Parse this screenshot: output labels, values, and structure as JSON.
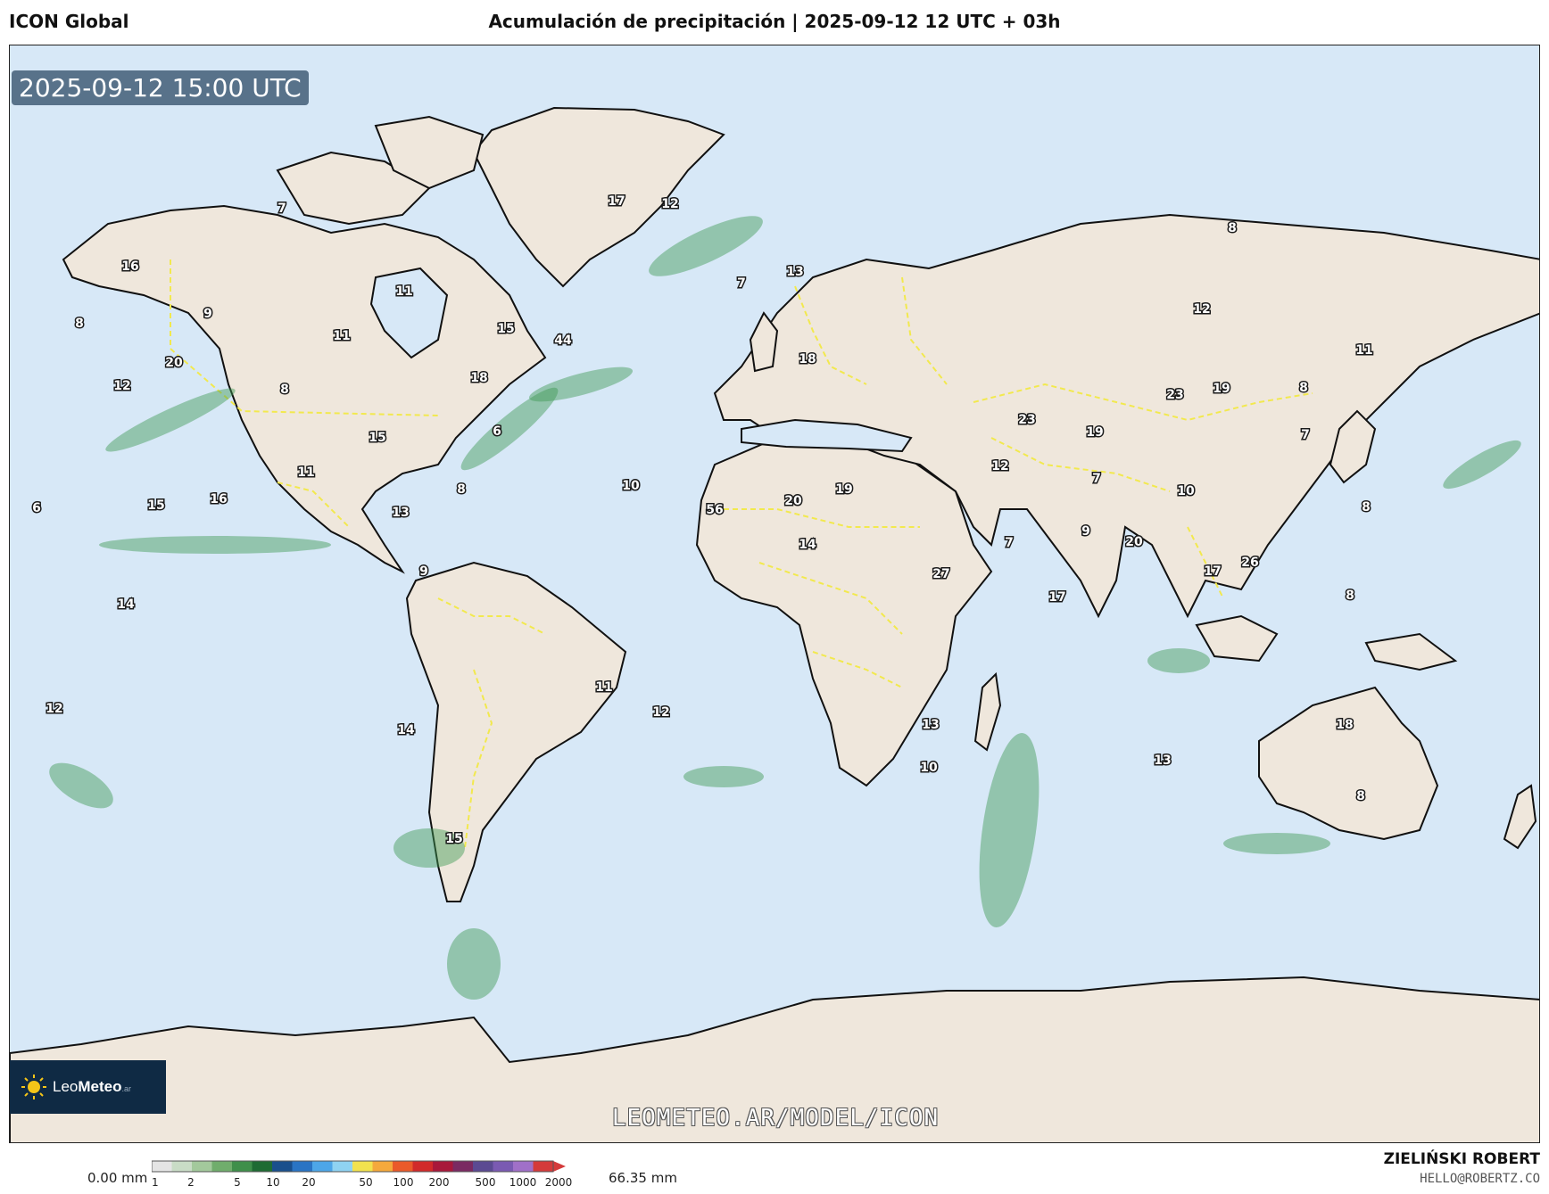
{
  "header": {
    "model": "ICON Global",
    "title": "Acumulación de precipitación | 2025-09-12 12 UTC + 03h"
  },
  "map": {
    "valid_time": "2025-09-12 15:00 UTC",
    "watermark": "LEOMETEO.AR/MODEL/ICON",
    "ocean_color": "#d7e8f7",
    "land_color": "#efe7dc",
    "border_color": "#f2e94e",
    "precip_color": "#3f9a52",
    "labels": [
      "17",
      "12",
      "7",
      "16",
      "11",
      "9",
      "8",
      "11",
      "15",
      "44",
      "20",
      "12",
      "18",
      "8",
      "15",
      "6",
      "11",
      "16",
      "15",
      "6",
      "8",
      "13",
      "9",
      "14",
      "12",
      "14",
      "15",
      "11",
      "12",
      "7",
      "13",
      "18",
      "10",
      "56",
      "20",
      "19",
      "14",
      "27",
      "7",
      "17",
      "23",
      "19",
      "12",
      "7",
      "9",
      "20",
      "26",
      "17",
      "12",
      "8",
      "11",
      "23",
      "19",
      "8",
      "7",
      "10",
      "8",
      "8",
      "18",
      "13",
      "13",
      "10",
      "8"
    ]
  },
  "logo": {
    "name_light": "Leo",
    "name_bold": "Meteo",
    "suffix": ".ar"
  },
  "legend": {
    "min_label": "0.00 mm",
    "max_label": "66.35 mm",
    "ticks": [
      "1",
      "2",
      "5",
      "10",
      "20",
      "50",
      "100",
      "200",
      "500",
      "1000",
      "2000"
    ],
    "colors": [
      "#e5e5e5",
      "#c9dcc6",
      "#a3c99c",
      "#70ad6c",
      "#3f8f4a",
      "#1e6b33",
      "#1a4f8c",
      "#2a74c4",
      "#4da6e8",
      "#8fd3f2",
      "#f2e24e",
      "#f5a93c",
      "#ea5a2a",
      "#d12a2a",
      "#a8183a",
      "#7a2a62",
      "#5b4a92",
      "#7a5ab2",
      "#a070c8",
      "#d43a3a"
    ]
  },
  "credit": {
    "name": "ZIELIŃSKI ROBERT",
    "email": "HELLO@ROBERTZ.CO"
  }
}
